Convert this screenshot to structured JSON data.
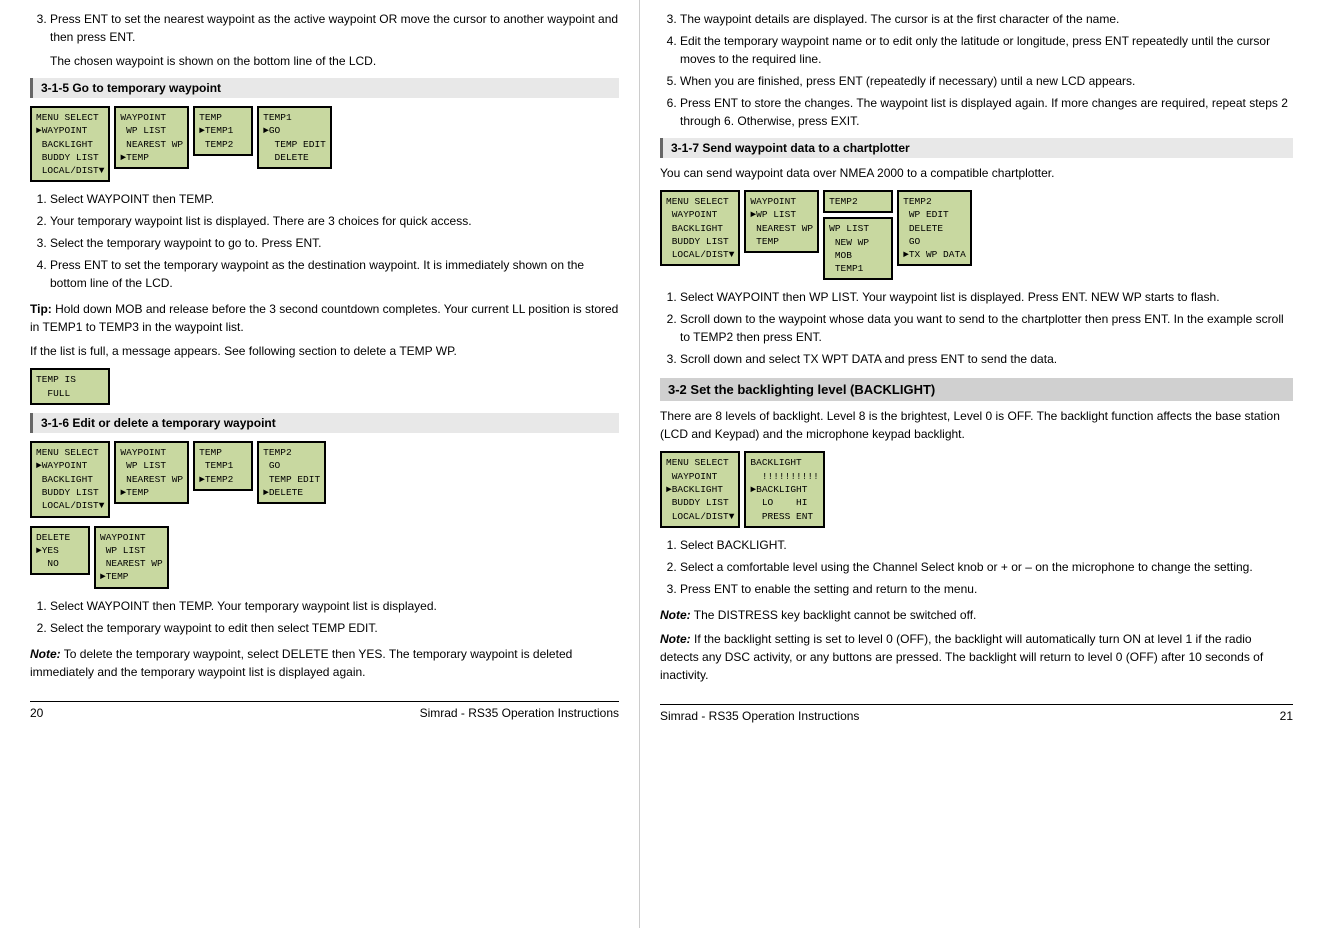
{
  "left": {
    "intro_text": "Press ENT to set the nearest waypoint as the active waypoint OR move the cursor to another waypoint and then press ENT.",
    "intro_text2": "The chosen waypoint is shown on the bottom line of the LCD.",
    "section_315": "3-1-5 Go to temporary waypoint",
    "lcd_315": [
      "MENU SELECT\n►WAYPOINT\n BACKLIGHT\n BUDDY LIST\n LOCAL/DIST▼",
      "WAYPOINT\n WP LIST\n NEAREST WP\n►TEMP",
      "TEMP\n►TEMP1\n TEMP2",
      "TEMP1\n►GO\n  TEMP EDIT\n  DELETE"
    ],
    "steps_315": [
      "Select WAYPOINT then TEMP.",
      "Your temporary waypoint list is displayed. There are 3 choices for quick access.",
      "Select the temporary waypoint to go to. Press ENT.",
      "Press ENT to set the temporary waypoint as the destination waypoint. It is immediately shown on the bottom line of the LCD."
    ],
    "tip_label": "Tip:",
    "tip_text": "Hold down MOB and release before the 3 second countdown completes. Your current LL position is stored in TEMP1 to TEMP3 in the waypoint list.",
    "temp_full_note": "If the list is full, a message appears. See following section to delete a TEMP WP.",
    "lcd_temp_full": "TEMP IS\n  FULL",
    "section_316": "3-1-6 Edit or delete a temporary waypoint",
    "lcd_316a": [
      "MENU SELECT\n►WAYPOINT\n BACKLIGHT\n BUDDY LIST\n LOCAL/DIST▼",
      "WAYPOINT\n WP LIST\n NEAREST WP\n►TEMP",
      "TEMP\n TEMP1\n►TEMP2",
      "TEMP2\n GO\n TEMP EDIT\n►DELETE"
    ],
    "lcd_316b": [
      "DELETE\n►YES\n  NO",
      "WAYPOINT\n WP LIST\n NEAREST WP\n►TEMP"
    ],
    "steps_316": [
      "Select WAYPOINT then TEMP. Your temporary waypoint list is displayed.",
      "Select the temporary waypoint to edit then select TEMP EDIT."
    ],
    "note_label": "Note:",
    "note_316": "To delete the temporary waypoint, select DELETE then YES. The temporary waypoint is deleted immediately and the temporary waypoint list is displayed again.",
    "footer_left_page": "20",
    "footer_left_text": "Simrad - RS35 Operation Instructions"
  },
  "right": {
    "steps_317_intro": [
      "The waypoint details are displayed. The cursor is at the first character of the name.",
      "Edit the temporary waypoint name or to edit only the latitude or longitude, press ENT repeatedly until the cursor moves to the required line.",
      "When you are finished, press ENT (repeatedly if necessary) until a new LCD appears.",
      "Press ENT to store the changes. The waypoint list is displayed again. If more changes are required, repeat steps 2 through 6. Otherwise, press EXIT."
    ],
    "section_317": "3-1-7 Send waypoint data to a chartplotter",
    "intro_317": "You can send waypoint data over NMEA 2000 to a compatible chartplotter.",
    "lcd_317": [
      "MENU SELECT\n WAYPOINT\n BACKLIGHT\n BUDDY LIST\n LOCAL/DIST▼",
      "WAYPOINT\n►WP LIST\n NEAREST WP\n TEMP",
      "WP LIST\n NEW WP\n MOB\n TEMP1",
      "TEMP2\n WP EDIT\n DELETE\n GO\n►TX WP DATA"
    ],
    "lcd_317_col3_extra": "TEMP2",
    "steps_317": [
      "Select WAYPOINT then WP LIST. Your waypoint list is displayed. Press ENT. NEW WP starts to flash.",
      "Scroll down to the waypoint whose data you want to send to the chartplotter then press ENT. In the example scroll to TEMP2 then press ENT.",
      "Scroll down and select TX WPT DATA and press ENT to send the data."
    ],
    "section_32": "3-2 Set the backlighting level (BACKLIGHT)",
    "intro_32": "There are 8 levels of backlight. Level 8 is the brightest, Level 0 is OFF. The backlight function affects the base station (LCD and Keypad) and the microphone keypad backlight.",
    "lcd_32": [
      "MENU SELECT\n WAYPOINT\n►BACKLIGHT\n BUDDY LIST\n LOCAL/DIST▼",
      "BACKLIGHT\n  !!!!!!!!!!\n►BACKLIGHT\n  LO    HI\n  PRESS ENT"
    ],
    "steps_32": [
      "Select BACKLIGHT.",
      "Select a comfortable level using the Channel Select knob or + or – on the microphone to change the setting.",
      "Press ENT to enable the setting and return to the menu."
    ],
    "note_32_label": "Note:",
    "note_32a": "The DISTRESS key backlight cannot be switched off.",
    "note_32b_label": "Note:",
    "note_32b": "If the backlight setting is set to level 0 (OFF), the backlight will automatically turn ON at  level 1 if the radio detects any DSC activity, or any buttons are pressed. The backlight will return to level 0 (OFF) after 10 seconds of inactivity.",
    "footer_right_page": "21",
    "footer_right_text": "Simrad - RS35 Operation Instructions"
  }
}
